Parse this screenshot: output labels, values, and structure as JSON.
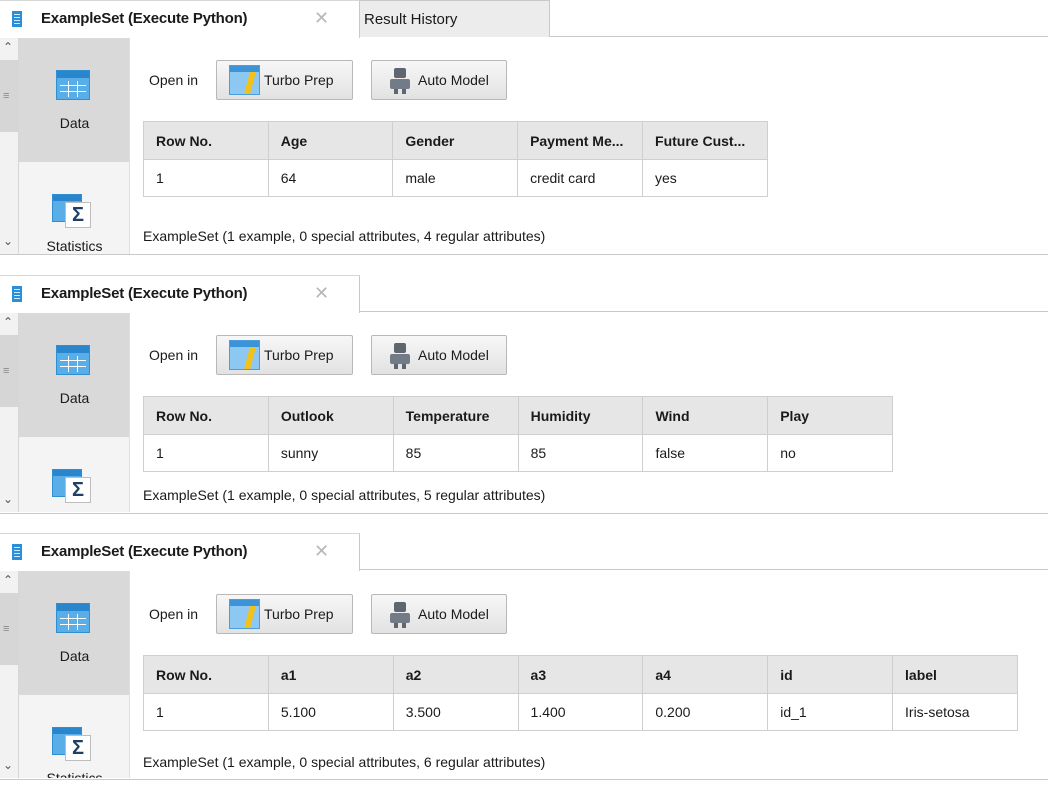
{
  "tabs": {
    "title": "ExampleSet (Execute Python)",
    "close": "✕",
    "result_history": "Result History"
  },
  "side": {
    "data_label": "Data",
    "statistics_label": "Statistics",
    "statistics_label_cut": "Statistics"
  },
  "toolbar": {
    "open_in": "Open in",
    "turbo_prep": "Turbo Prep",
    "auto_model": "Auto Model"
  },
  "panels": [
    {
      "columns": [
        "Row No.",
        "Age",
        "Gender",
        "Payment Me...",
        "Future Cust..."
      ],
      "row": [
        "1",
        "64",
        "male",
        "credit card",
        "yes"
      ],
      "summary": "ExampleSet (1 example, 0 special attributes, 4 regular attributes)"
    },
    {
      "columns": [
        "Row No.",
        "Outlook",
        "Temperature",
        "Humidity",
        "Wind",
        "Play"
      ],
      "row": [
        "1",
        "sunny",
        "85",
        "85",
        "false",
        "no"
      ],
      "summary": "ExampleSet (1 example, 0 special attributes, 5 regular attributes)"
    },
    {
      "columns": [
        "Row No.",
        "a1",
        "a2",
        "a3",
        "a4",
        "id",
        "label"
      ],
      "row": [
        "1",
        "5.100",
        "3.500",
        "1.400",
        "0.200",
        "id_1",
        "Iris-setosa"
      ],
      "summary": "ExampleSet (1 example, 0 special attributes, 6 regular attributes)"
    }
  ],
  "colors": {
    "accent_blue": "#2a8fd8",
    "header_gray": "#e6e6e6",
    "selected_side": "#d9d9d9"
  },
  "icons": [
    "exampleset-icon",
    "close-icon",
    "data-grid-icon",
    "statistics-icon",
    "turbo-prep-icon",
    "auto-model-icon",
    "scroll-up-icon",
    "scroll-down-icon"
  ]
}
